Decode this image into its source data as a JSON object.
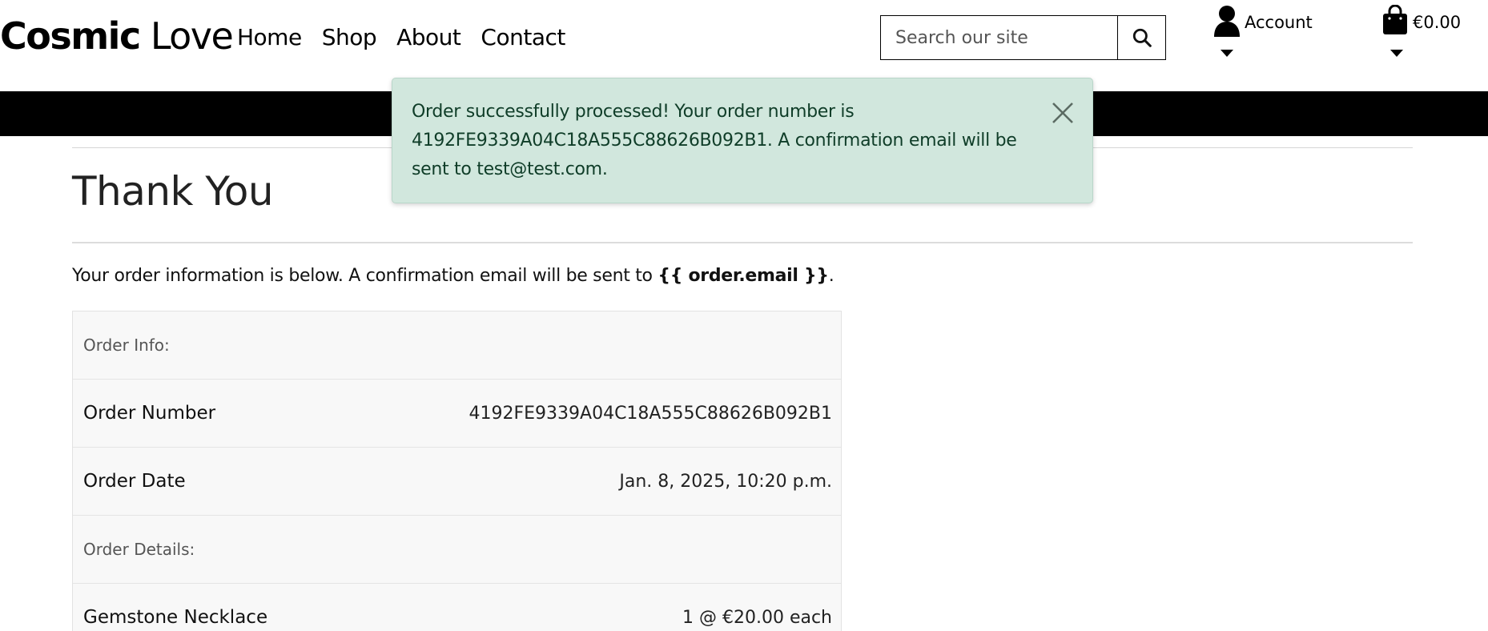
{
  "header": {
    "logo_bold": "Cosmic",
    "logo_light": "Love",
    "nav": [
      "Home",
      "Shop",
      "About",
      "Contact"
    ],
    "search_placeholder": "Search our site",
    "account_label": "Account",
    "bag_total": "€0.00"
  },
  "alert": {
    "message": "Order successfully processed! Your order number is 4192FE9339A04C18A555C88626B092B1. A confirmation email will be sent to test@test.com."
  },
  "page": {
    "title": "Thank You",
    "intro_text": "Your order information is below. A confirmation email will be sent to ",
    "intro_email": "{{ order.email }}",
    "intro_end": "."
  },
  "order_table": {
    "section_info": "Order Info:",
    "rows": [
      {
        "label": "Order Number",
        "value": "4192FE9339A04C18A555C88626B092B1"
      },
      {
        "label": "Order Date",
        "value": "Jan. 8, 2025, 10:20 p.m."
      }
    ],
    "section_details": "Order Details:",
    "item_label": "Gemstone Necklace",
    "item_value": "1 @ €20.00 each"
  },
  "colors": {
    "alert_bg": "#d1e7dd",
    "banner_bg": "#000000"
  }
}
